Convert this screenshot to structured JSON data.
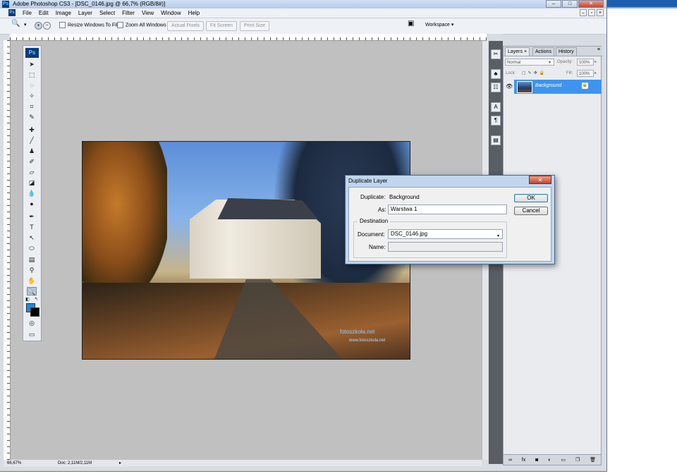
{
  "window": {
    "title": "Adobe Photoshop CS3 - [DSC_0146.jpg @ 66,7% (RGB/8#)]",
    "app_badge": "Ps"
  },
  "menu": [
    "File",
    "Edit",
    "Image",
    "Layer",
    "Select",
    "Filter",
    "View",
    "Window",
    "Help"
  ],
  "options": {
    "resize_windows": "Resize Windows To Fit",
    "zoom_all": "Zoom All Windows",
    "actual_pixels": "Actual Pixels",
    "fit_screen": "Fit Screen",
    "print_size": "Print Size",
    "workspace": "Workspace"
  },
  "toolbox": {
    "badge": "Ps",
    "fg_color": "#1d8ae6",
    "bg_color": "#000000"
  },
  "layers_panel": {
    "tabs": [
      "Layers",
      "Actions",
      "History"
    ],
    "blend_mode": "Normal",
    "opacity_label": "Opacity:",
    "opacity_value": "100%",
    "lock_label": "Lock:",
    "fill_label": "Fill:",
    "fill_value": "100%",
    "layer_name": "Background"
  },
  "photo": {
    "watermark": "fotoszkoła.net",
    "watermark_sub": "www.fotoszkola.net"
  },
  "status": {
    "zoom": "66,67%",
    "doc": "Doc: 2,11M/2,11M"
  },
  "dialog": {
    "title": "Duplicate Layer",
    "duplicate_label": "Duplicate:",
    "duplicate_value": "Background",
    "as_label": "As:",
    "as_value": "Warstwa 1",
    "destination_legend": "Destination",
    "document_label": "Document:",
    "document_value": "DSC_0146.jpg",
    "name_label": "Name:",
    "ok_label": "OK",
    "cancel_label": "Cancel"
  }
}
